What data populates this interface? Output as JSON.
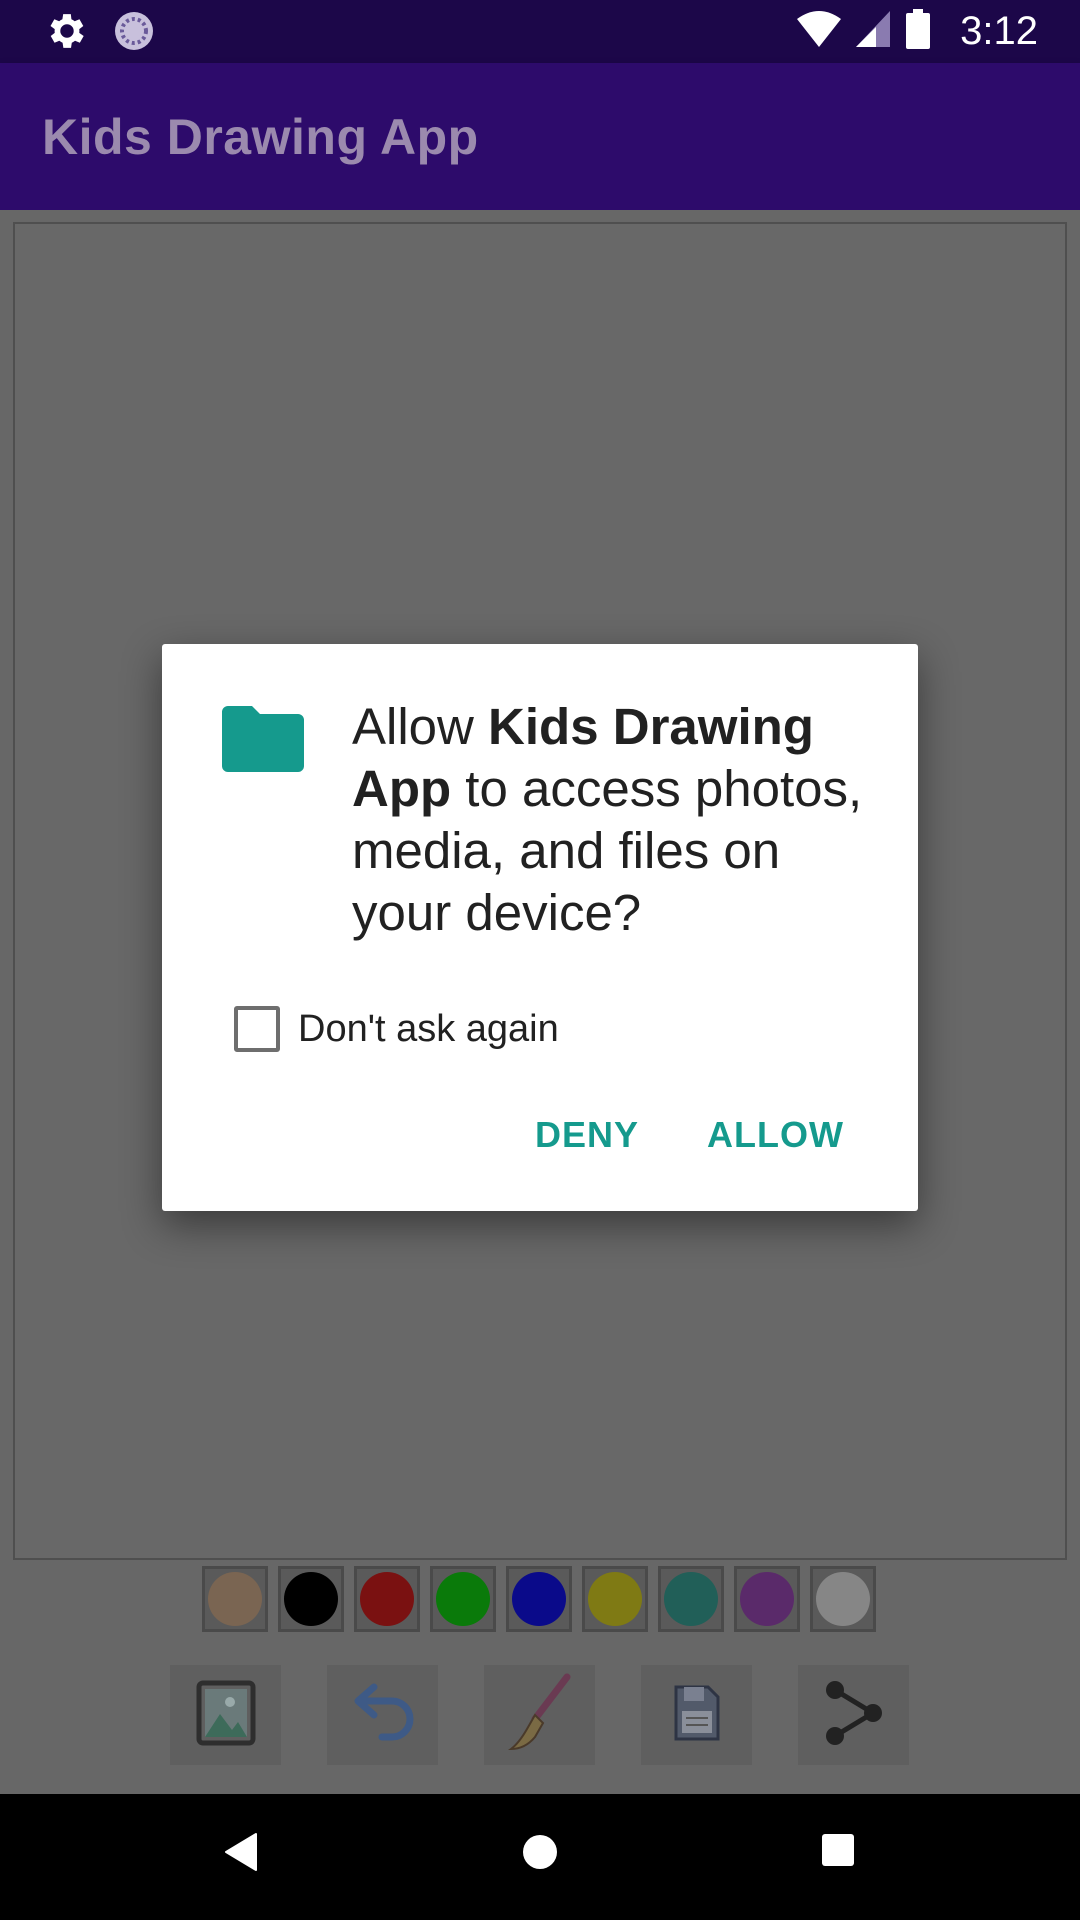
{
  "status_bar": {
    "time": "3:12",
    "icons": [
      "gear-icon",
      "loading-icon",
      "wifi-icon",
      "signal-icon",
      "battery-icon"
    ]
  },
  "app_bar": {
    "title": "Kids Drawing App"
  },
  "palette": {
    "colors": [
      "#c09468",
      "#000000",
      "#8e0f0f",
      "#008a00",
      "#0000a8",
      "#b8b000",
      "#1f6b63",
      "#6b2b80",
      "#e8e8e8"
    ]
  },
  "toolbar": {
    "icons": [
      "gallery-icon",
      "undo-icon",
      "brush-icon",
      "save-icon",
      "share-icon"
    ]
  },
  "dialog": {
    "message_prefix": "Allow ",
    "app_name": "Kids Drawing App",
    "message_suffix": " to access photos, media, and files on your device?",
    "checkbox_label": "Don't ask again",
    "checkbox_checked": false,
    "deny_label": "DENY",
    "allow_label": "ALLOW",
    "accent_color": "#159a8d"
  },
  "nav_bar": {
    "buttons": [
      "back-icon",
      "home-icon",
      "recents-icon"
    ]
  }
}
